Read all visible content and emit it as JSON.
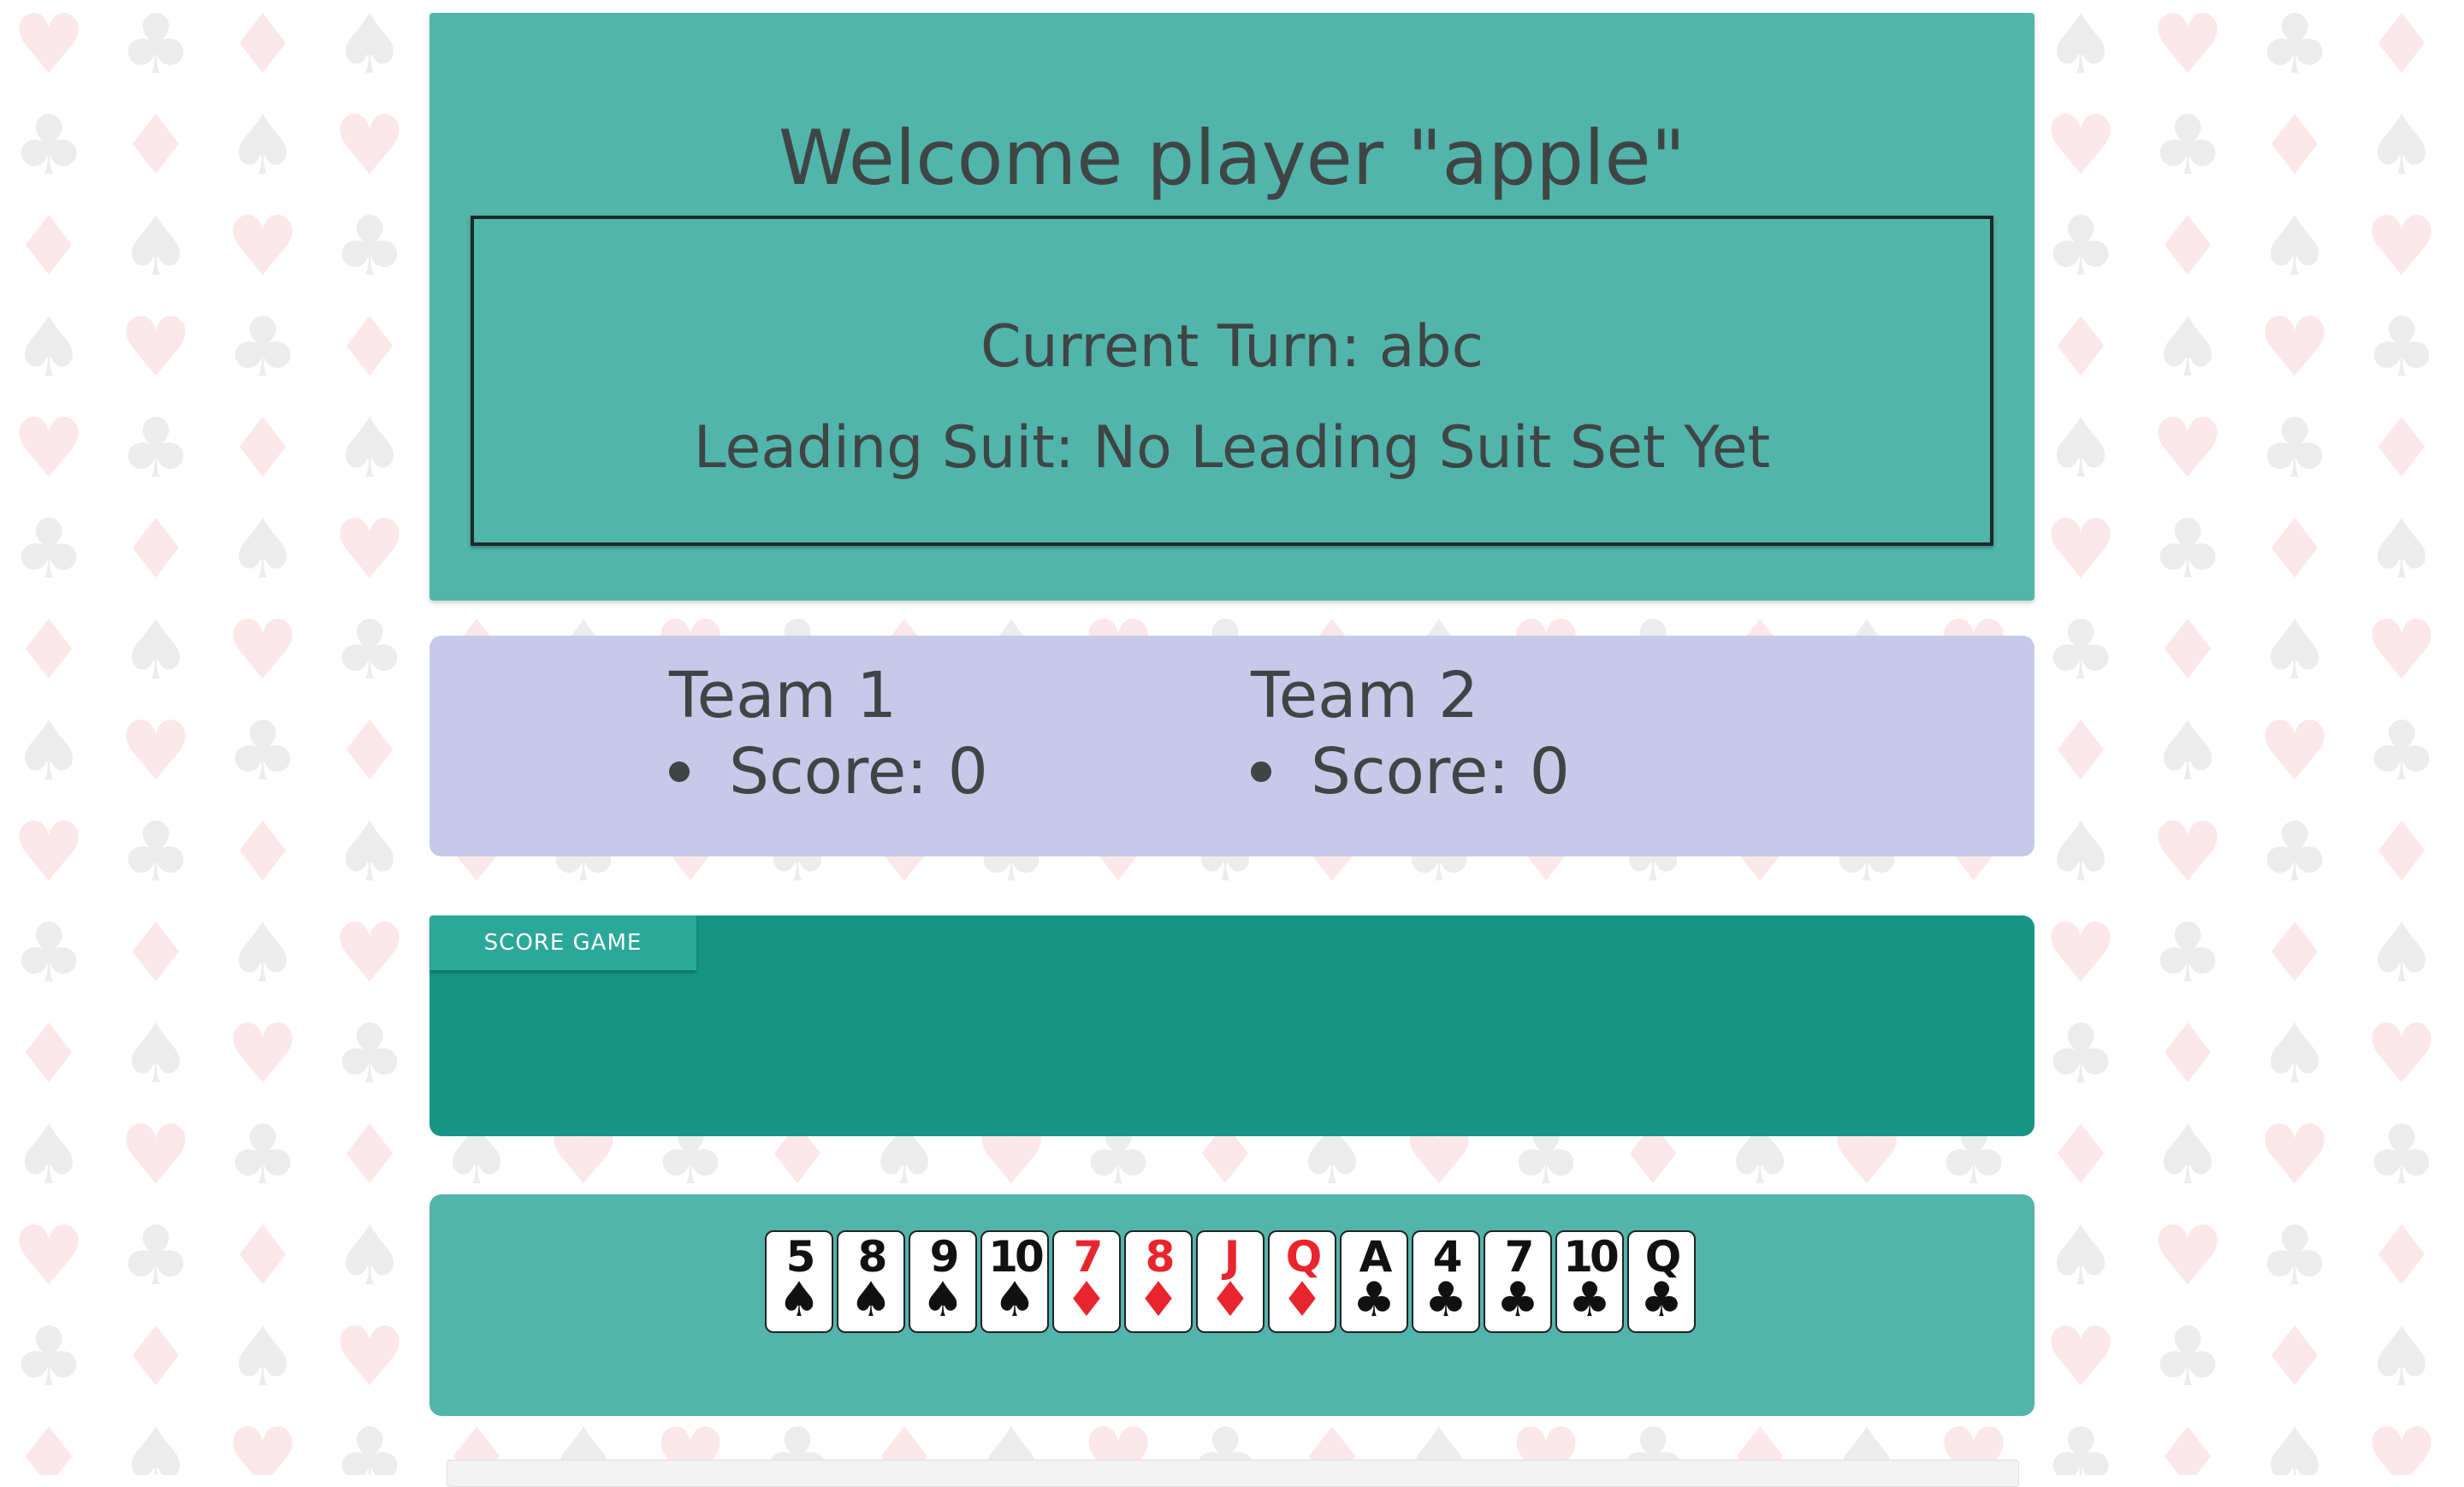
{
  "header": {
    "welcome": "Welcome player \"apple\"",
    "current_turn": "Current Turn: abc",
    "leading_suit": "Leading Suit: No Leading Suit Set Yet"
  },
  "scores": {
    "teams": [
      {
        "name": "Team 1",
        "score": "Score: 0"
      },
      {
        "name": "Team 2",
        "score": "Score: 0"
      }
    ]
  },
  "actions": {
    "score_game_label": "SCORE GAME"
  },
  "hand": {
    "cards": [
      {
        "rank": "5",
        "suit": "♠",
        "color": "black",
        "icon": "spade-icon"
      },
      {
        "rank": "8",
        "suit": "♠",
        "color": "black",
        "icon": "spade-icon"
      },
      {
        "rank": "9",
        "suit": "♠",
        "color": "black",
        "icon": "spade-icon"
      },
      {
        "rank": "10",
        "suit": "♠",
        "color": "black",
        "icon": "spade-icon"
      },
      {
        "rank": "7",
        "suit": "♦",
        "color": "red",
        "icon": "diamond-icon"
      },
      {
        "rank": "8",
        "suit": "♦",
        "color": "red",
        "icon": "diamond-icon"
      },
      {
        "rank": "J",
        "suit": "♦",
        "color": "red",
        "icon": "diamond-icon"
      },
      {
        "rank": "Q",
        "suit": "♦",
        "color": "red",
        "icon": "diamond-icon"
      },
      {
        "rank": "A",
        "suit": "♣",
        "color": "black",
        "icon": "club-icon"
      },
      {
        "rank": "4",
        "suit": "♣",
        "color": "black",
        "icon": "club-icon"
      },
      {
        "rank": "7",
        "suit": "♣",
        "color": "black",
        "icon": "club-icon"
      },
      {
        "rank": "10",
        "suit": "♣",
        "color": "black",
        "icon": "club-icon"
      },
      {
        "rank": "Q",
        "suit": "♣",
        "color": "black",
        "icon": "club-icon"
      }
    ]
  },
  "colors": {
    "header_panel": "#52b5ac",
    "scores_panel": "#c6c9e8",
    "actions_panel": "#169587",
    "card_red": "#e8252d",
    "card_black": "#111111"
  }
}
